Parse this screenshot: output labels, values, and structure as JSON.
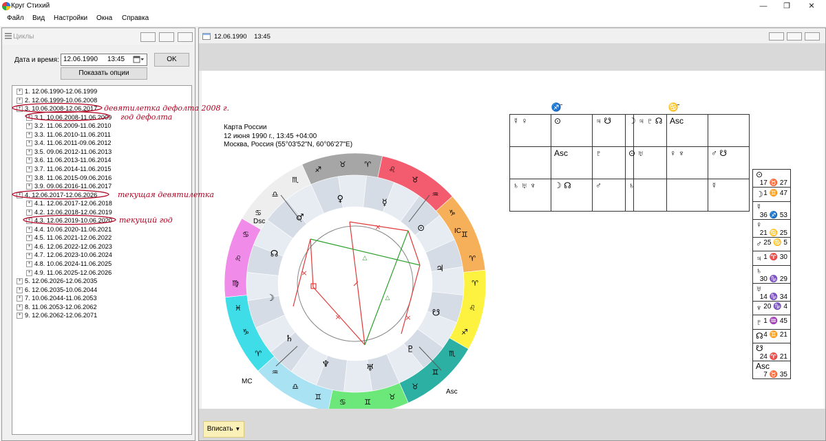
{
  "app": {
    "title": "Круг Стихий"
  },
  "window_controls": {
    "minimize": "—",
    "maximize": "❐",
    "close": "✕"
  },
  "menu": [
    "Файл",
    "Вид",
    "Настройки",
    "Окна",
    "Справка"
  ],
  "cycles_panel": {
    "title": "Циклы",
    "date_label": "Дата и время:",
    "date_value": "12.06.1990",
    "time_value": "13:45",
    "ok_label": "OK",
    "options_label": "Показать опции",
    "tree": [
      {
        "label": "1. 12.06.1990-12.06.1999",
        "level": 0
      },
      {
        "label": "2. 12.06.1999-10.06.2008",
        "level": 0
      },
      {
        "label": "3. 10.06.2008-12.06.2017",
        "level": 0
      },
      {
        "label": "3.1. 10.06.2008-11.06.2009",
        "level": 1
      },
      {
        "label": "3.2. 11.06.2009-11.06.2010",
        "level": 1
      },
      {
        "label": "3.3. 11.06.2010-11.06.2011",
        "level": 1
      },
      {
        "label": "3.4. 11.06.2011-09.06.2012",
        "level": 1
      },
      {
        "label": "3.5. 09.06.2012-11.06.2013",
        "level": 1
      },
      {
        "label": "3.6. 11.06.2013-11.06.2014",
        "level": 1
      },
      {
        "label": "3.7. 11.06.2014-11.06.2015",
        "level": 1
      },
      {
        "label": "3.8. 11.06.2015-09.06.2016",
        "level": 1
      },
      {
        "label": "3.9. 09.06.2016-11.06.2017",
        "level": 1
      },
      {
        "label": "4. 12.06.2017-12.06.2026",
        "level": 0
      },
      {
        "label": "4.1. 12.06.2017-12.06.2018",
        "level": 1
      },
      {
        "label": "4.2. 12.06.2018-12.06.2019",
        "level": 1
      },
      {
        "label": "4.3. 12.06.2019-10.06.2020",
        "level": 1
      },
      {
        "label": "4.4. 10.06.2020-11.06.2021",
        "level": 1
      },
      {
        "label": "4.5. 11.06.2021-12.06.2022",
        "level": 1
      },
      {
        "label": "4.6. 12.06.2022-12.06.2023",
        "level": 1
      },
      {
        "label": "4.7. 12.06.2023-10.06.2024",
        "level": 1
      },
      {
        "label": "4.8. 10.06.2024-11.06.2025",
        "level": 1
      },
      {
        "label": "4.9. 11.06.2025-12.06.2026",
        "level": 1
      },
      {
        "label": "5. 12.06.2026-12.06.2035",
        "level": 0
      },
      {
        "label": "6. 12.06.2035-10.06.2044",
        "level": 0
      },
      {
        "label": "7. 10.06.2044-11.06.2053",
        "level": 0
      },
      {
        "label": "8. 11.06.2053-12.06.2062",
        "level": 0
      },
      {
        "label": "9. 12.06.2062-12.06.2071",
        "level": 0
      }
    ],
    "annotations": [
      "девятилетка дефолта 2008 г.",
      "год дефолта",
      "текущая девятилетка",
      "текущий год"
    ]
  },
  "chart_window": {
    "title": "12.06.1990    13:45",
    "info": [
      "Карта России",
      "12 июня 1990 г., 13:45 +04:00",
      "Москва, Россия (55°03'52\"N, 60°06'27\"E)"
    ],
    "insert_label": "Вписать",
    "axis_labels": {
      "dsc": "Dsc",
      "ic": "IC",
      "mc": "MC",
      "asc": "Asc"
    },
    "grid_left": {
      "title": "♐̄",
      "cells": [
        [
          "☿ ♀",
          "⊙",
          "♃ ☋"
        ],
        [
          "",
          "Asc",
          "♇"
        ],
        [
          "♄ ♅ ♆",
          "☽ ☊",
          "♂"
        ]
      ]
    },
    "grid_right": {
      "title": "♋̄",
      "cells": [
        [
          "☽ ♃ ♇ ☊",
          "Asc",
          ""
        ],
        [
          "⊙ ♅",
          "♀ ♆",
          "♂ ☋"
        ],
        [
          "♄",
          "",
          "☿"
        ]
      ]
    },
    "planets": [
      {
        "glyph": "⊙",
        "value": "17 ♉ 27"
      },
      {
        "glyph": "☽",
        "value": "1 ♊ 47"
      },
      {
        "glyph": "☿",
        "value": "36 ♐ 53"
      },
      {
        "glyph": "♀",
        "value": "21 ♋ 25"
      },
      {
        "glyph": "♂",
        "value": "25 ♋ 5"
      },
      {
        "glyph": "♃",
        "value": "1 ♈ 30"
      },
      {
        "glyph": "♄",
        "value": "30 ♑ 29"
      },
      {
        "glyph": "♅",
        "value": "14 ♑ 34"
      },
      {
        "glyph": "♆",
        "value": "20 ♑ 4"
      },
      {
        "glyph": "♇",
        "value": "1 ♒ 45"
      },
      {
        "glyph": "☊",
        "value": "4 ♊ 21"
      },
      {
        "glyph": "☋",
        "value": "24 ♈ 21"
      },
      {
        "glyph": "Asc",
        "value": "7 ♉ 35"
      }
    ],
    "outer_ring": [
      {
        "color": "#a6a6a6",
        "labels": [
          "♐̄",
          "♉",
          "♈"
        ]
      },
      {
        "color": "#f25c6e",
        "labels": [
          "♌",
          "♉̄",
          "♒"
        ]
      },
      {
        "color": "#f7b05a",
        "labels": [
          "♑",
          "♊",
          "♈"
        ]
      },
      {
        "color": "#fdf240",
        "labels": [
          "♈",
          "♌",
          "♐"
        ]
      },
      {
        "color": "#2bb0a3",
        "labels": [
          "♏",
          "♊",
          "♉"
        ]
      },
      {
        "color": "#6ce77a",
        "labels": [
          "♉",
          "♊",
          "♋"
        ]
      },
      {
        "color": "#a9e2f3",
        "labels": [
          "♊",
          "♎",
          "♒"
        ]
      },
      {
        "color": "#3fdde8",
        "labels": [
          "♈",
          "♑",
          "♓"
        ]
      },
      {
        "color": "#f18be9",
        "labels": [
          "♍",
          "♌",
          "♋"
        ]
      },
      {
        "color": "#eeeeee",
        "labels": [
          "♋",
          "♎",
          "♏"
        ]
      }
    ],
    "planet_glyphs": [
      {
        "glyph": "♀"
      },
      {
        "glyph": "☿"
      },
      {
        "glyph": "⊙"
      },
      {
        "glyph": "♃"
      },
      {
        "glyph": "☋"
      },
      {
        "glyph": "♇"
      },
      {
        "glyph": "♅"
      },
      {
        "glyph": "♆"
      },
      {
        "glyph": "♄"
      },
      {
        "glyph": "☽"
      },
      {
        "glyph": "☊"
      },
      {
        "glyph": "♂"
      }
    ]
  }
}
